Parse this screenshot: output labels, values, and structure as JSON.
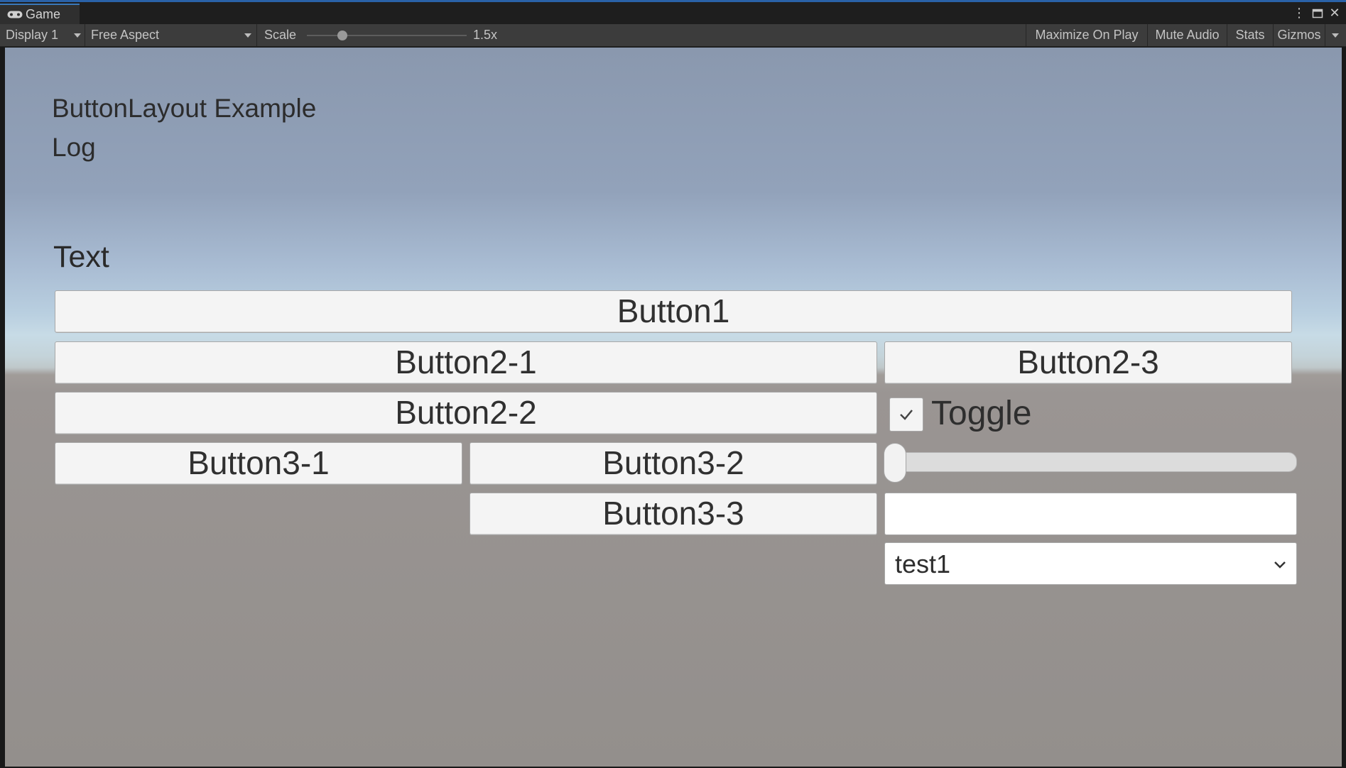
{
  "window": {
    "tab_label": "Game",
    "tab_icon": "gamepad-icon",
    "controls": [
      "more-options-icon",
      "maximize-icon",
      "close-icon"
    ]
  },
  "toolbar": {
    "display": "Display 1",
    "aspect": "Free Aspect",
    "scale_label": "Scale",
    "scale_value": "1.5x",
    "scale_level": 0.22,
    "maximize_on_play": "Maximize On Play",
    "mute_audio": "Mute Audio",
    "stats": "Stats",
    "gizmos": "Gizmos"
  },
  "game": {
    "title": "ButtonLayout Example",
    "log": "Log",
    "text": "Text",
    "buttons": {
      "b1": "Button1",
      "b2_1": "Button2-1",
      "b2_2": "Button2-2",
      "b2_3": "Button2-3",
      "b3_1": "Button3-1",
      "b3_2": "Button3-2",
      "b3_3": "Button3-3"
    },
    "toggle": {
      "label": "Toggle",
      "checked": true
    },
    "slider": {
      "value": 0.0
    },
    "input": {
      "value": ""
    },
    "dropdown": {
      "selected": "test1"
    }
  },
  "colors": {
    "editor_dark": "#1e1e1e",
    "toolbar": "#3c3c3c",
    "accent": "#3a79bb",
    "sky": "#a8bbd2",
    "ground": "#938f8c"
  }
}
